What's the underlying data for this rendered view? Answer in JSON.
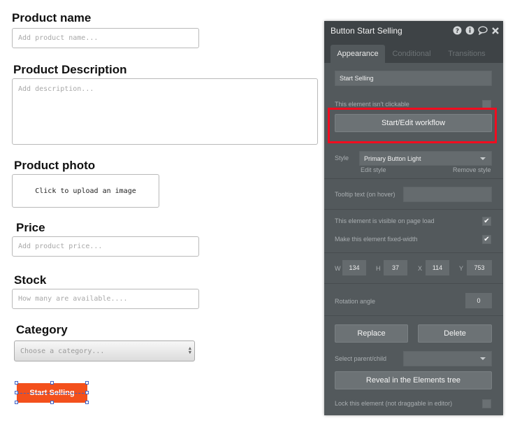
{
  "form": {
    "product_name": {
      "label": "Product name",
      "placeholder": "Add product name..."
    },
    "product_description": {
      "label": "Product Description",
      "placeholder": "Add description..."
    },
    "product_photo": {
      "label": "Product photo",
      "upload_text": "Click to upload an image"
    },
    "price": {
      "label": "Price",
      "placeholder": "Add product price..."
    },
    "stock": {
      "label": "Stock",
      "placeholder": "How many are available...."
    },
    "category": {
      "label": "Category",
      "placeholder": "Choose a category..."
    },
    "cta": {
      "label": "Start Selling",
      "color": "#f3501c"
    }
  },
  "panel": {
    "title": "Button Start Selling",
    "header_icons": [
      "help-icon",
      "info-icon",
      "comment-icon",
      "close-icon"
    ],
    "tabs": [
      "Appearance",
      "Conditional",
      "Transitions"
    ],
    "active_tab": "Appearance",
    "button_text": "Start Selling",
    "not_clickable_label": "This element isn't clickable",
    "not_clickable_checked": false,
    "workflow_button": "Start/Edit workflow",
    "style_label": "Style",
    "style_value": "Primary Button Light",
    "edit_style": "Edit style",
    "remove_style": "Remove style",
    "tooltip_label": "Tooltip text (on hover)",
    "tooltip_value": "",
    "visible_label": "This element is visible on page load",
    "visible_checked": true,
    "fixed_width_label": "Make this element fixed-width",
    "fixed_width_checked": true,
    "dims": {
      "w_label": "W",
      "w": "134",
      "h_label": "H",
      "h": "37",
      "x_label": "X",
      "x": "114",
      "y_label": "Y",
      "y": "753"
    },
    "rotation_label": "Rotation angle",
    "rotation_value": "0",
    "replace_button": "Replace",
    "delete_button": "Delete",
    "select_parent_label": "Select parent/child",
    "reveal_button": "Reveal in the Elements tree",
    "lock_label": "Lock this element (not draggable in editor)",
    "lock_checked": false,
    "highlight_color": "#f20c1f"
  }
}
